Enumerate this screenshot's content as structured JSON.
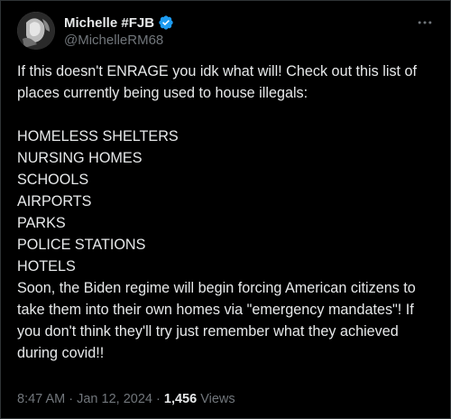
{
  "author": {
    "display_name": "Michelle #FJB",
    "handle": "@MichelleRM68",
    "verified_badge_icon": "verified-badge-icon",
    "avatar_icon": "avatar-photo"
  },
  "tweet": {
    "intro": "If this doesn't ENRAGE you idk what will! Check out this list of places currently being used to house illegals:",
    "list": [
      "HOMELESS SHELTERS",
      "NURSING HOMES",
      "SCHOOLS",
      "AIRPORTS",
      "PARKS",
      "POLICE STATIONS",
      "HOTELS"
    ],
    "closing": "Soon, the Biden regime will begin forcing American citizens to take them into their own homes via  \"emergency mandates\"! If you don't think they'll try just remember what they achieved during covid!!"
  },
  "meta": {
    "time": "8:47 AM",
    "separator": "·",
    "date": "Jan 12, 2024",
    "views_count": "1,456",
    "views_label": "Views"
  },
  "more_menu_icon": "more-horizontal-icon",
  "colors": {
    "background": "#000000",
    "text": "#e7e9ea",
    "secondary_text": "#71767b",
    "verified_blue": "#1d9bf0"
  }
}
